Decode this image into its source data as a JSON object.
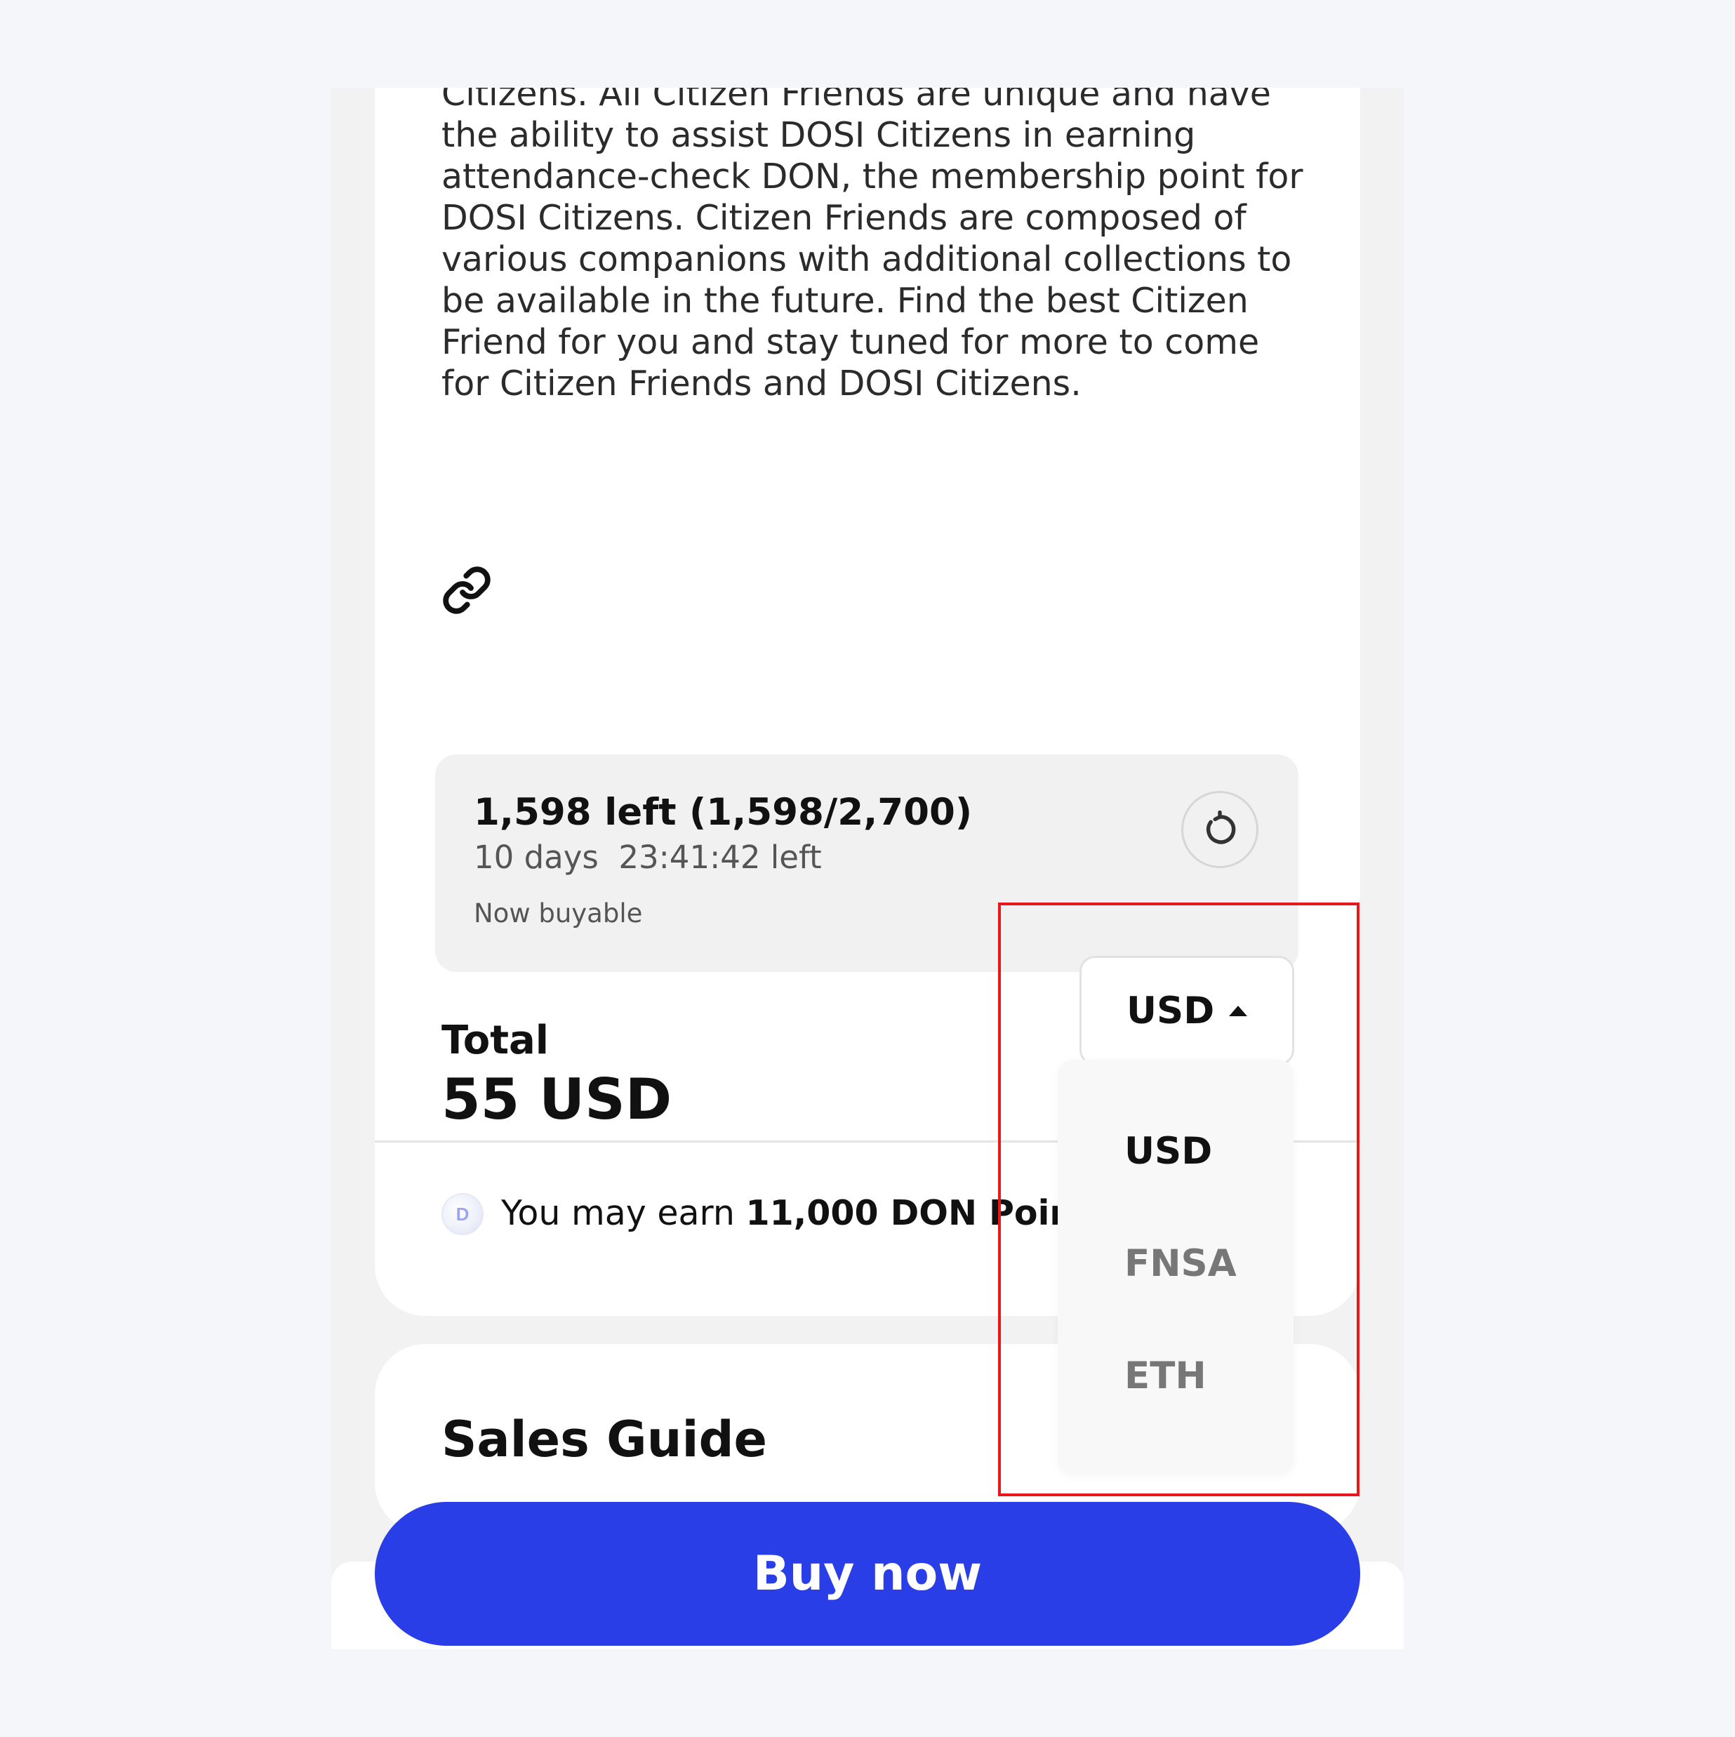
{
  "description": "Citizen Friends are a special companion for DOSI Citizens. All Citizen Friends are unique and have the ability to assist DOSI Citizens in earning attendance-check DON, the membership point for DOSI Citizens. Citizen Friends are composed of various companions with additional collections to be available in the future. Find the best Citizen Friend for you and stay tuned for more to come for Citizen Friends and DOSI Citizens.",
  "stock": {
    "count_text": "1,598 left (1,598/2,700)",
    "time_left": "10 days  23:41:42 left",
    "status": "Now buyable"
  },
  "total": {
    "label": "Total",
    "value": "55 USD"
  },
  "currency": {
    "selected": "USD",
    "options": [
      "USD",
      "FNSA",
      "ETH"
    ]
  },
  "don": {
    "prefix": "You may earn ",
    "amount": "11,000 DON Points"
  },
  "sales_guide": {
    "title": "Sales Guide"
  },
  "buy_button": {
    "label": "Buy now"
  },
  "colors": {
    "primary": "#2a3ee8",
    "highlight": "#e8171c",
    "text": "#111111",
    "muted": "#555555",
    "option_inactive": "#777777"
  }
}
